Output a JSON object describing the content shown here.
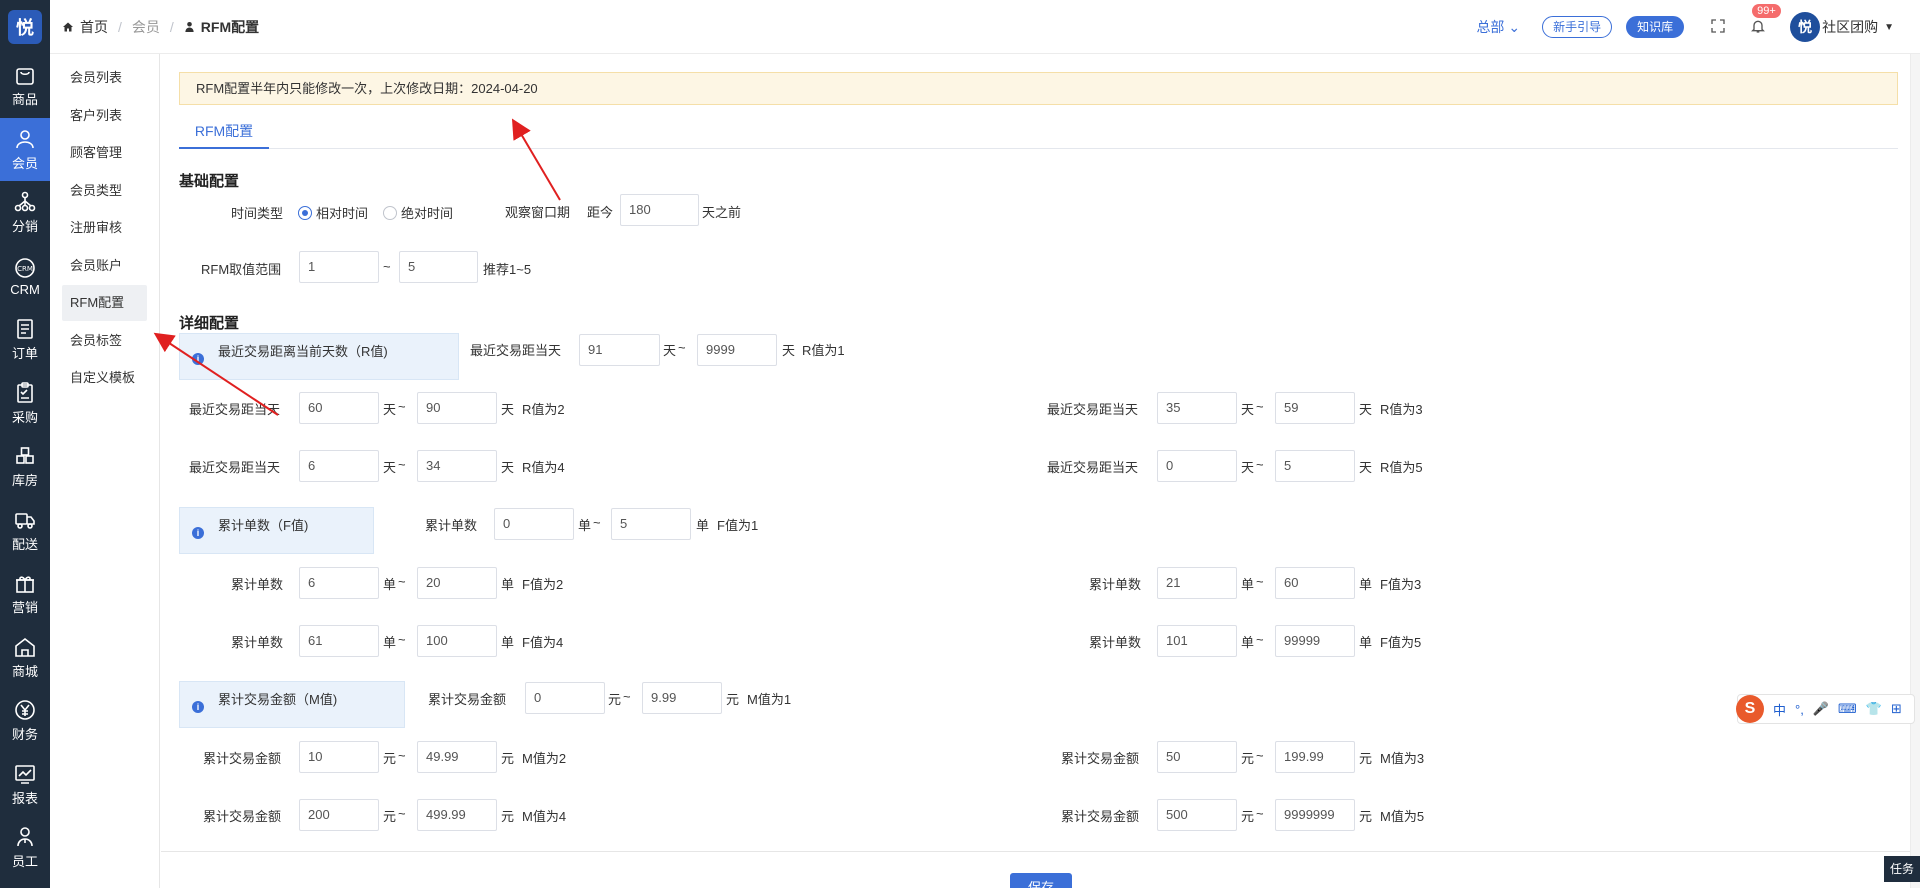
{
  "rail": {
    "logo": "悦",
    "items": [
      {
        "label": "商品",
        "icon": "bag-icon"
      },
      {
        "label": "会员",
        "icon": "user-icon"
      },
      {
        "label": "分销",
        "icon": "network-icon"
      },
      {
        "label": "CRM",
        "icon": "crm-icon"
      },
      {
        "label": "订单",
        "icon": "order-icon"
      },
      {
        "label": "采购",
        "icon": "clipboard-icon"
      },
      {
        "label": "库房",
        "icon": "warehouse-icon"
      },
      {
        "label": "配送",
        "icon": "truck-icon"
      },
      {
        "label": "营销",
        "icon": "gift-icon"
      },
      {
        "label": "商城",
        "icon": "home-icon"
      },
      {
        "label": "财务",
        "icon": "yen-icon"
      },
      {
        "label": "报表",
        "icon": "chart-icon"
      },
      {
        "label": "员工",
        "icon": "staff-icon"
      }
    ]
  },
  "subnav": {
    "items": [
      "会员列表",
      "客户列表",
      "顾客管理",
      "会员类型",
      "注册审核",
      "会员账户",
      "RFM配置",
      "会员标签",
      "自定义模板"
    ]
  },
  "breadcrumb": {
    "home": "首页",
    "level2": "会员",
    "current": "RFM配置"
  },
  "topbar": {
    "hq": "总部",
    "guide": "新手引导",
    "kb": "知识库",
    "badge": "99+",
    "avatar": "悦",
    "user": "社区团购"
  },
  "notice": "RFM配置半年内只能修改一次，上次修改日期：2024-04-20",
  "tab": "RFM配置",
  "basic": {
    "title": "基础配置",
    "time_type_label": "时间类型",
    "radio_relative": "相对时间",
    "radio_absolute": "绝对时间",
    "window_label": "观察窗口期",
    "distance_label": "距今",
    "window_value": "180",
    "window_suffix": "天之前",
    "range_label": "RFM取值范围",
    "range_min": "1",
    "tilde": "~",
    "range_max": "5",
    "range_hint": "推荐1~5"
  },
  "detail": {
    "title": "详细配置",
    "r": {
      "title": "最近交易距离当前天数（R值)",
      "label": "最近交易距当天",
      "unit": "天",
      "rows": [
        {
          "from": "91",
          "to": "9999",
          "result": "R值为1"
        },
        {
          "from": "60",
          "to": "90",
          "result": "R值为2"
        },
        {
          "from": "35",
          "to": "59",
          "result": "R值为3"
        },
        {
          "from": "6",
          "to": "34",
          "result": "R值为4"
        },
        {
          "from": "0",
          "to": "5",
          "result": "R值为5"
        }
      ]
    },
    "f": {
      "title": "累计单数（F值)",
      "label": "累计单数",
      "unit": "单",
      "rows": [
        {
          "from": "0",
          "to": "5",
          "result": "F值为1"
        },
        {
          "from": "6",
          "to": "20",
          "result": "F值为2"
        },
        {
          "from": "21",
          "to": "60",
          "result": "F值为3"
        },
        {
          "from": "61",
          "to": "100",
          "result": "F值为4"
        },
        {
          "from": "101",
          "to": "99999",
          "result": "F值为5"
        }
      ]
    },
    "m": {
      "title": "累计交易金额（M值)",
      "label": "累计交易金额",
      "unit": "元",
      "rows": [
        {
          "from": "0",
          "to": "9.99",
          "result": "M值为1"
        },
        {
          "from": "10",
          "to": "49.99",
          "result": "M值为2"
        },
        {
          "from": "50",
          "to": "199.99",
          "result": "M值为3"
        },
        {
          "from": "200",
          "to": "499.99",
          "result": "M值为4"
        },
        {
          "from": "500",
          "to": "9999999",
          "result": "M值为5"
        }
      ]
    }
  },
  "save": "保存",
  "ime": {
    "logo": "S",
    "chars": [
      "中",
      "°,",
      "🎤",
      "⌨",
      "👕",
      "⊞"
    ]
  },
  "task": "任务",
  "colors": {
    "primary": "#3b6fd8",
    "rail": "#1f2d3d",
    "notice_bg": "#fdf6e4",
    "arrow": "#e02020"
  }
}
